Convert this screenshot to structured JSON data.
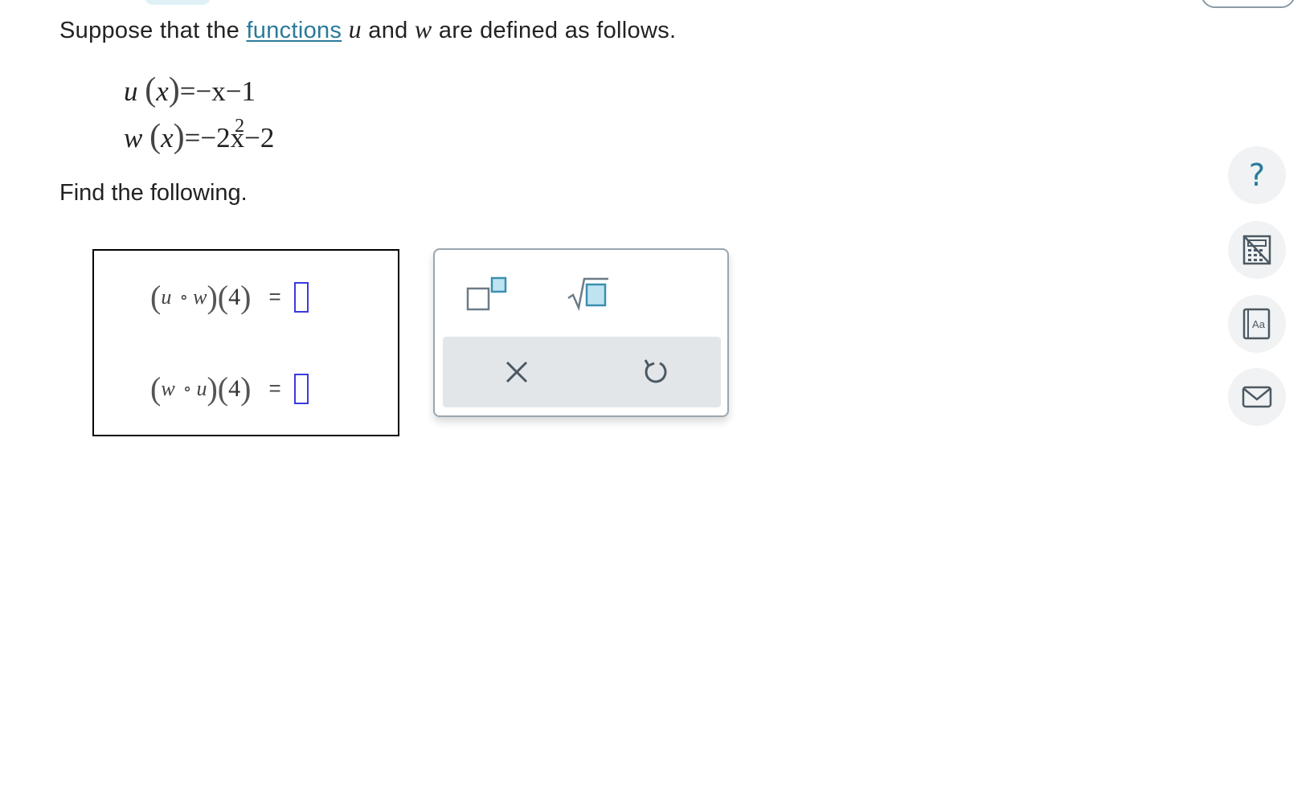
{
  "problem": {
    "intro_before": "Suppose that the ",
    "link": "functions",
    "var_u": "u",
    "and": " and ",
    "var_w": "w",
    "intro_after": " are defined as follows."
  },
  "definitions": {
    "u": {
      "name": "u",
      "arg": "x",
      "rhs": "=−x−1"
    },
    "w": {
      "name": "w",
      "arg": "x",
      "rhs_a": "=−2x",
      "exp": "2",
      "rhs_b": "−2"
    }
  },
  "find_text": "Find the following.",
  "answers": [
    {
      "outer": "u",
      "inner": "w",
      "arg": "4",
      "eq": "="
    },
    {
      "outer": "w",
      "inner": "u",
      "arg": "4",
      "eq": "="
    }
  ],
  "palette": {
    "buttons": [
      "superscript-icon",
      "square-root-icon"
    ],
    "actions": [
      "clear-icon",
      "undo-icon"
    ]
  },
  "side_tools": {
    "help_glyph": "?",
    "dictionary_glyph": "Aa"
  },
  "colors": {
    "link": "#2a7a9a",
    "accent": "#2a7a9a",
    "input_border": "#3a3adf",
    "palette_action_bg": "#e3e6e9"
  }
}
